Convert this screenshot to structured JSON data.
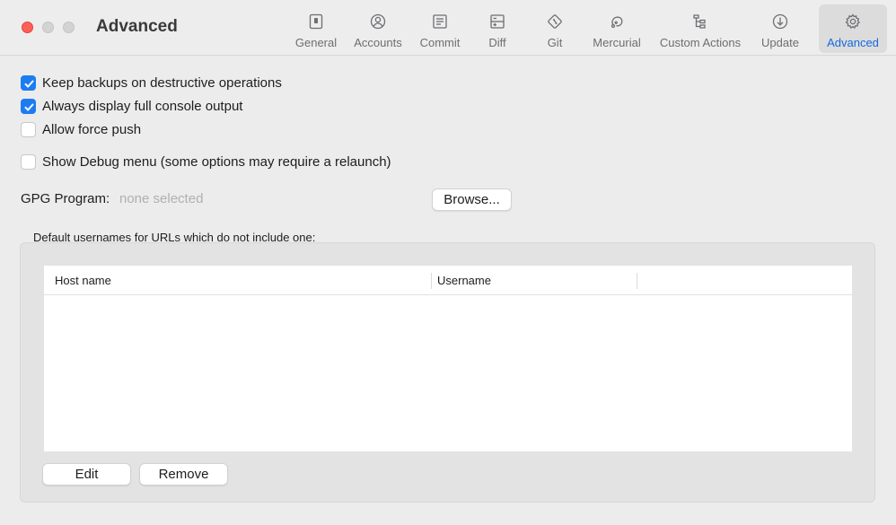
{
  "window": {
    "title": "Advanced"
  },
  "toolbar": {
    "tabs": [
      {
        "label": "General",
        "icon": "general-icon",
        "active": false
      },
      {
        "label": "Accounts",
        "icon": "accounts-icon",
        "active": false
      },
      {
        "label": "Commit",
        "icon": "commit-icon",
        "active": false
      },
      {
        "label": "Diff",
        "icon": "diff-icon",
        "active": false
      },
      {
        "label": "Git",
        "icon": "git-icon",
        "active": false
      },
      {
        "label": "Mercurial",
        "icon": "mercurial-icon",
        "active": false
      },
      {
        "label": "Custom Actions",
        "icon": "custom-actions-icon",
        "active": false
      },
      {
        "label": "Update",
        "icon": "update-icon",
        "active": false
      },
      {
        "label": "Advanced",
        "icon": "gear-icon",
        "active": true
      }
    ]
  },
  "options": [
    {
      "label": "Keep backups on destructive operations",
      "checked": true
    },
    {
      "label": "Always display full console output",
      "checked": true
    },
    {
      "label": "Allow force push",
      "checked": false
    },
    {
      "label": "Show Debug menu (some options may require a relaunch)",
      "checked": false
    }
  ],
  "gpg": {
    "label": "GPG Program:",
    "value": "none selected",
    "browse_label": "Browse..."
  },
  "usernames": {
    "section_label": "Default usernames for URLs which do not include one:",
    "columns": [
      "Host name",
      "Username"
    ],
    "rows": [],
    "edit_label": "Edit",
    "remove_label": "Remove"
  },
  "colors": {
    "accent": "#1d7cf2",
    "active_tab_text": "#1769e0",
    "close_button": "#fe5f57"
  }
}
